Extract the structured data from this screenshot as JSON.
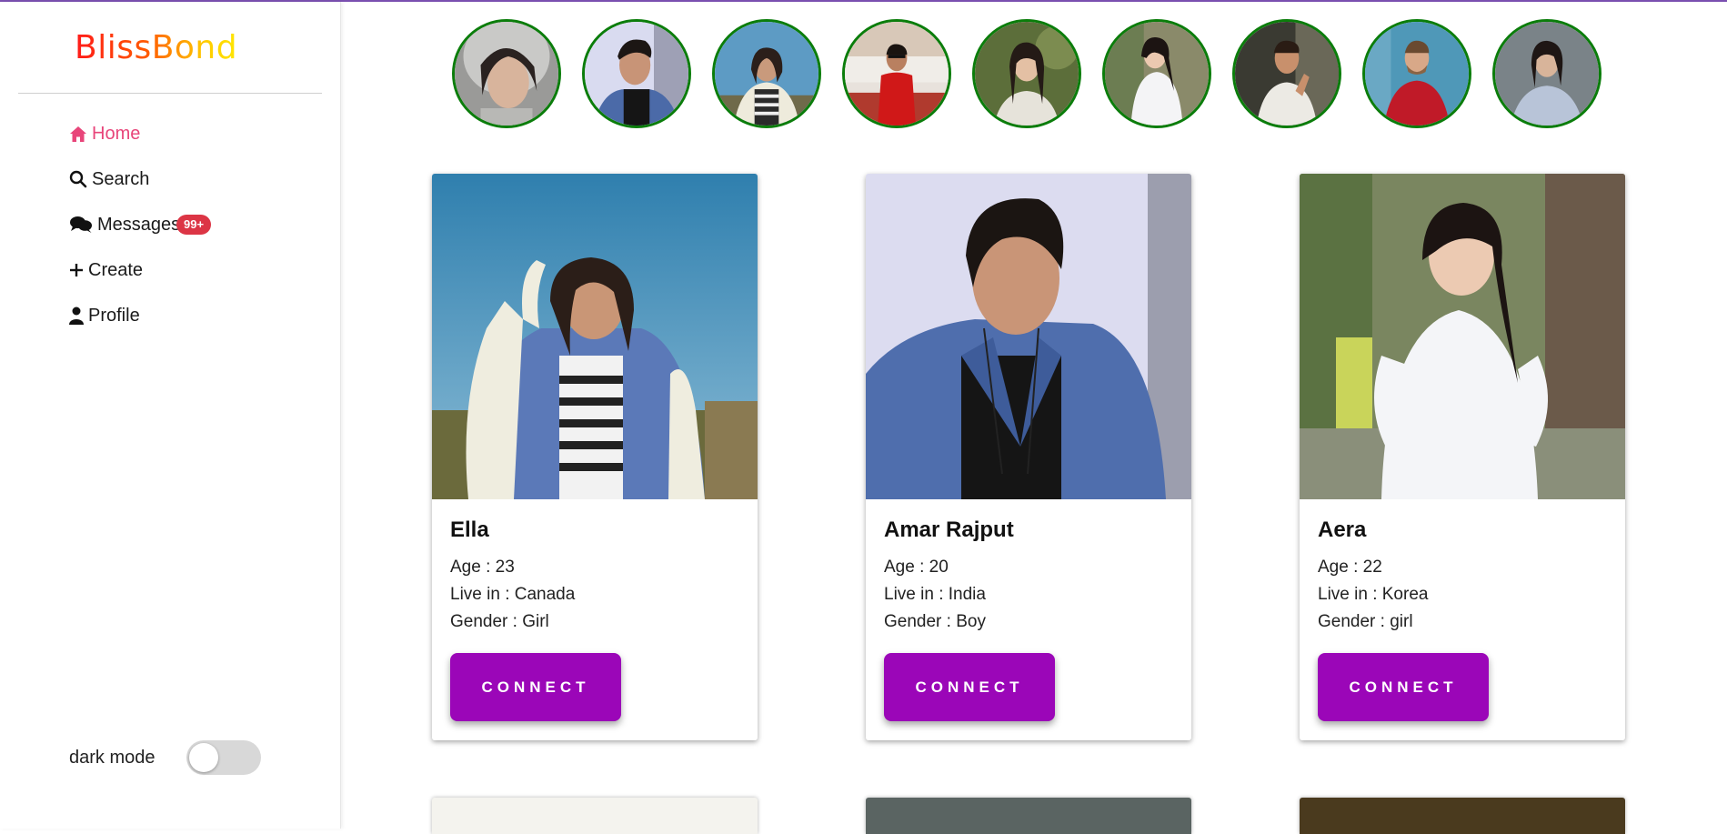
{
  "app": {
    "logo": "BlissBond"
  },
  "sidebar": {
    "items": [
      {
        "label": "Home",
        "icon": "home-icon",
        "active": true
      },
      {
        "label": "Search",
        "icon": "search-icon"
      },
      {
        "label": "Messages",
        "icon": "chat-bubbles-icon",
        "badge": "99+"
      },
      {
        "label": "Create",
        "icon": "plus-icon"
      },
      {
        "label": "Profile",
        "icon": "user-icon"
      }
    ],
    "dark_mode_label": "dark mode",
    "dark_mode_on": false
  },
  "stories": [
    {
      "avatar": "woman-hood"
    },
    {
      "avatar": "man-denim"
    },
    {
      "avatar": "woman-sky"
    },
    {
      "avatar": "man-red"
    },
    {
      "avatar": "woman-garden"
    },
    {
      "avatar": "woman-white-dress"
    },
    {
      "avatar": "man-white-tee"
    },
    {
      "avatar": "man-red-sweater"
    },
    {
      "avatar": "woman-grey"
    }
  ],
  "profiles": [
    {
      "name": "Ella",
      "age": "Age : 23",
      "live": "Live in : Canada",
      "gender": "Gender : Girl",
      "button": "CONNECT"
    },
    {
      "name": "Amar Rajput",
      "age": "Age : 20",
      "live": "Live in : India",
      "gender": "Gender : Boy",
      "button": "CONNECT"
    },
    {
      "name": "Aera",
      "age": "Age : 22",
      "live": "Live in : Korea",
      "gender": "Gender : girl",
      "button": "CONNECT"
    }
  ],
  "colors": {
    "accent": "#9b06b8",
    "active_nav": "#e8457a",
    "badge": "#dc3545",
    "story_ring": "#0b7d0b"
  }
}
